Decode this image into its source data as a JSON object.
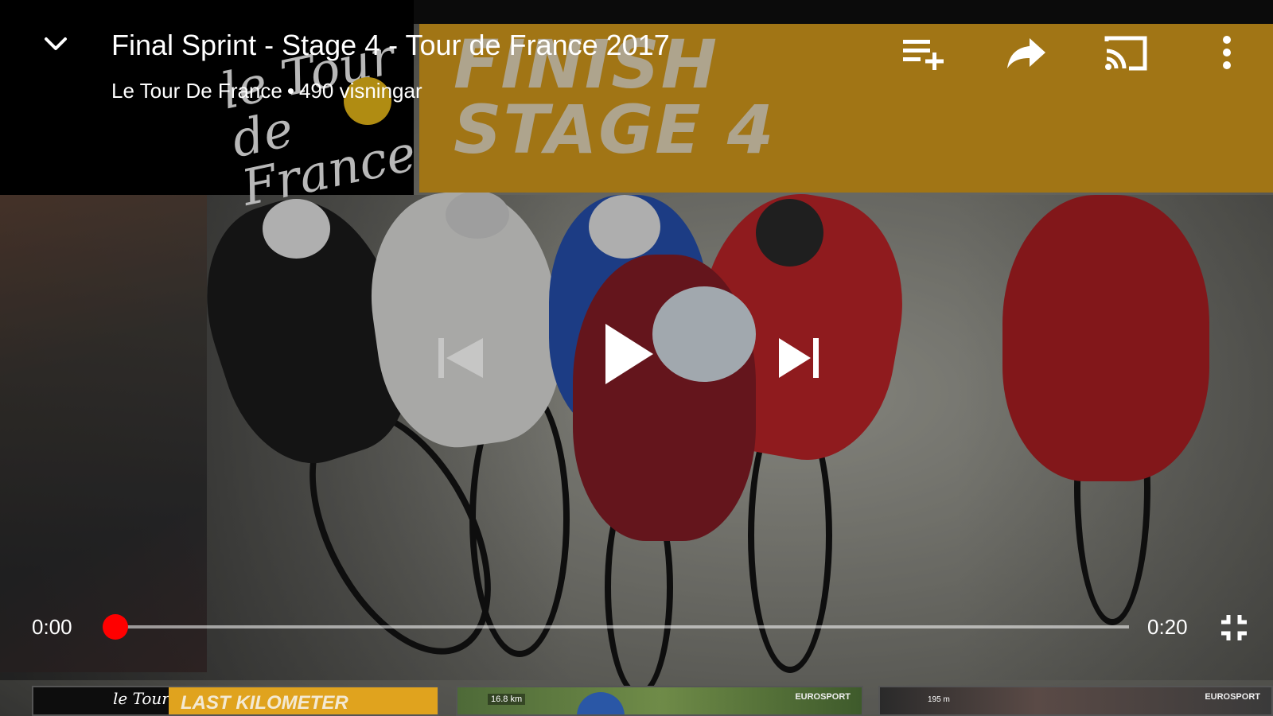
{
  "video": {
    "title": "Final Sprint - Stage 4 - Tour de France 2017",
    "channel": "Le Tour De France",
    "separator": "•",
    "views": "490 visningar",
    "graphics": {
      "logo_text": "le Tour de France",
      "banner_line1": "FINISH",
      "banner_line2": "STAGE 4"
    }
  },
  "player": {
    "time_current": "0:00",
    "time_duration": "0:20",
    "progress_fraction": 0.0,
    "state": "paused",
    "accent_color": "#ff0000"
  },
  "icons": {
    "collapse": "chevron-down-icon",
    "add_to_playlist": "playlist-add-icon",
    "share": "share-icon",
    "cast": "cast-icon",
    "more": "more-vertical-icon",
    "previous": "skip-previous-icon",
    "play": "play-icon",
    "next": "skip-next-icon",
    "exit_fullscreen": "fullscreen-exit-icon"
  },
  "suggestions": [
    {
      "label": "LAST KILOMETER",
      "logo": "le Tour"
    },
    {
      "tag": "EUROSPORT",
      "stat": "16.8 km"
    },
    {
      "tag": "EUROSPORT",
      "stat": "195 m"
    }
  ]
}
